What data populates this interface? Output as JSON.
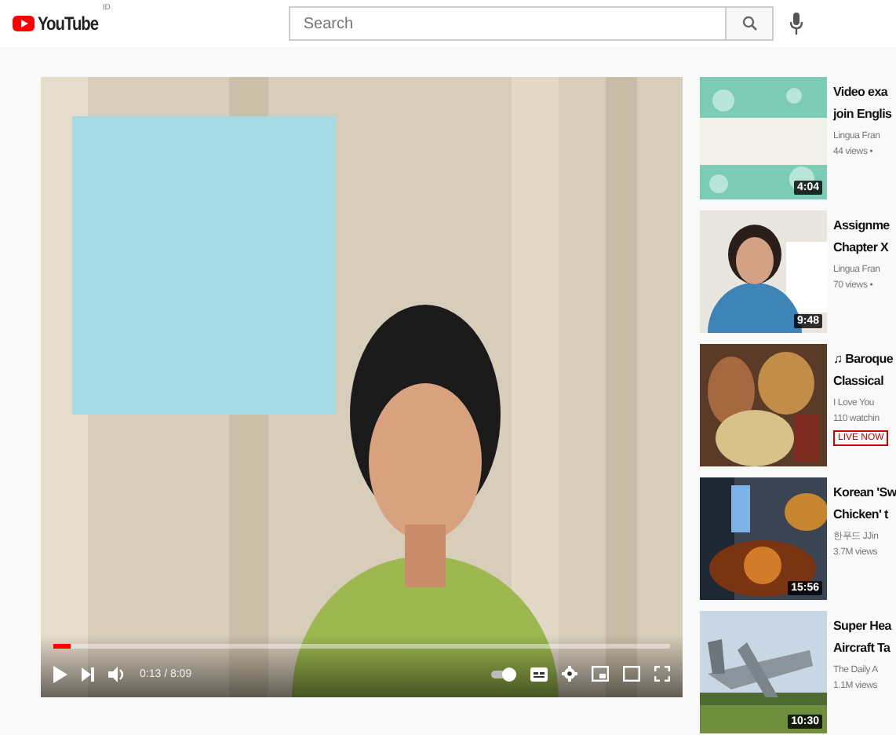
{
  "header": {
    "logo": "YouTube",
    "region": "ID",
    "search": {
      "placeholder": "Search"
    }
  },
  "player": {
    "time": "0:13 / 8:09",
    "level": 0.027,
    "autoplay": true
  },
  "related": [
    {
      "title_lines": [
        "Video exa",
        "join Englis"
      ],
      "channel": "Lingua Fran",
      "meta": "44 views •",
      "duration": "4:04"
    },
    {
      "title_lines": [
        "Assignme",
        "Chapter X"
      ],
      "channel": "Lingua Fran",
      "meta": "70 views •",
      "duration": "9:48"
    },
    {
      "title_lines": [
        "♫ Baroque",
        "Classical"
      ],
      "channel": "I Love You",
      "meta": "110 watchin",
      "badge": "LIVE NOW"
    },
    {
      "title_lines": [
        "Korean 'Sw",
        "Chicken' t"
      ],
      "channel": "한푸드 JJin",
      "meta": "3.7M views",
      "duration": "15:56"
    },
    {
      "title_lines": [
        "Super Hea",
        "Aircraft Ta"
      ],
      "channel": "The Daily A",
      "meta": "1.1M views",
      "duration": "10:30"
    }
  ]
}
